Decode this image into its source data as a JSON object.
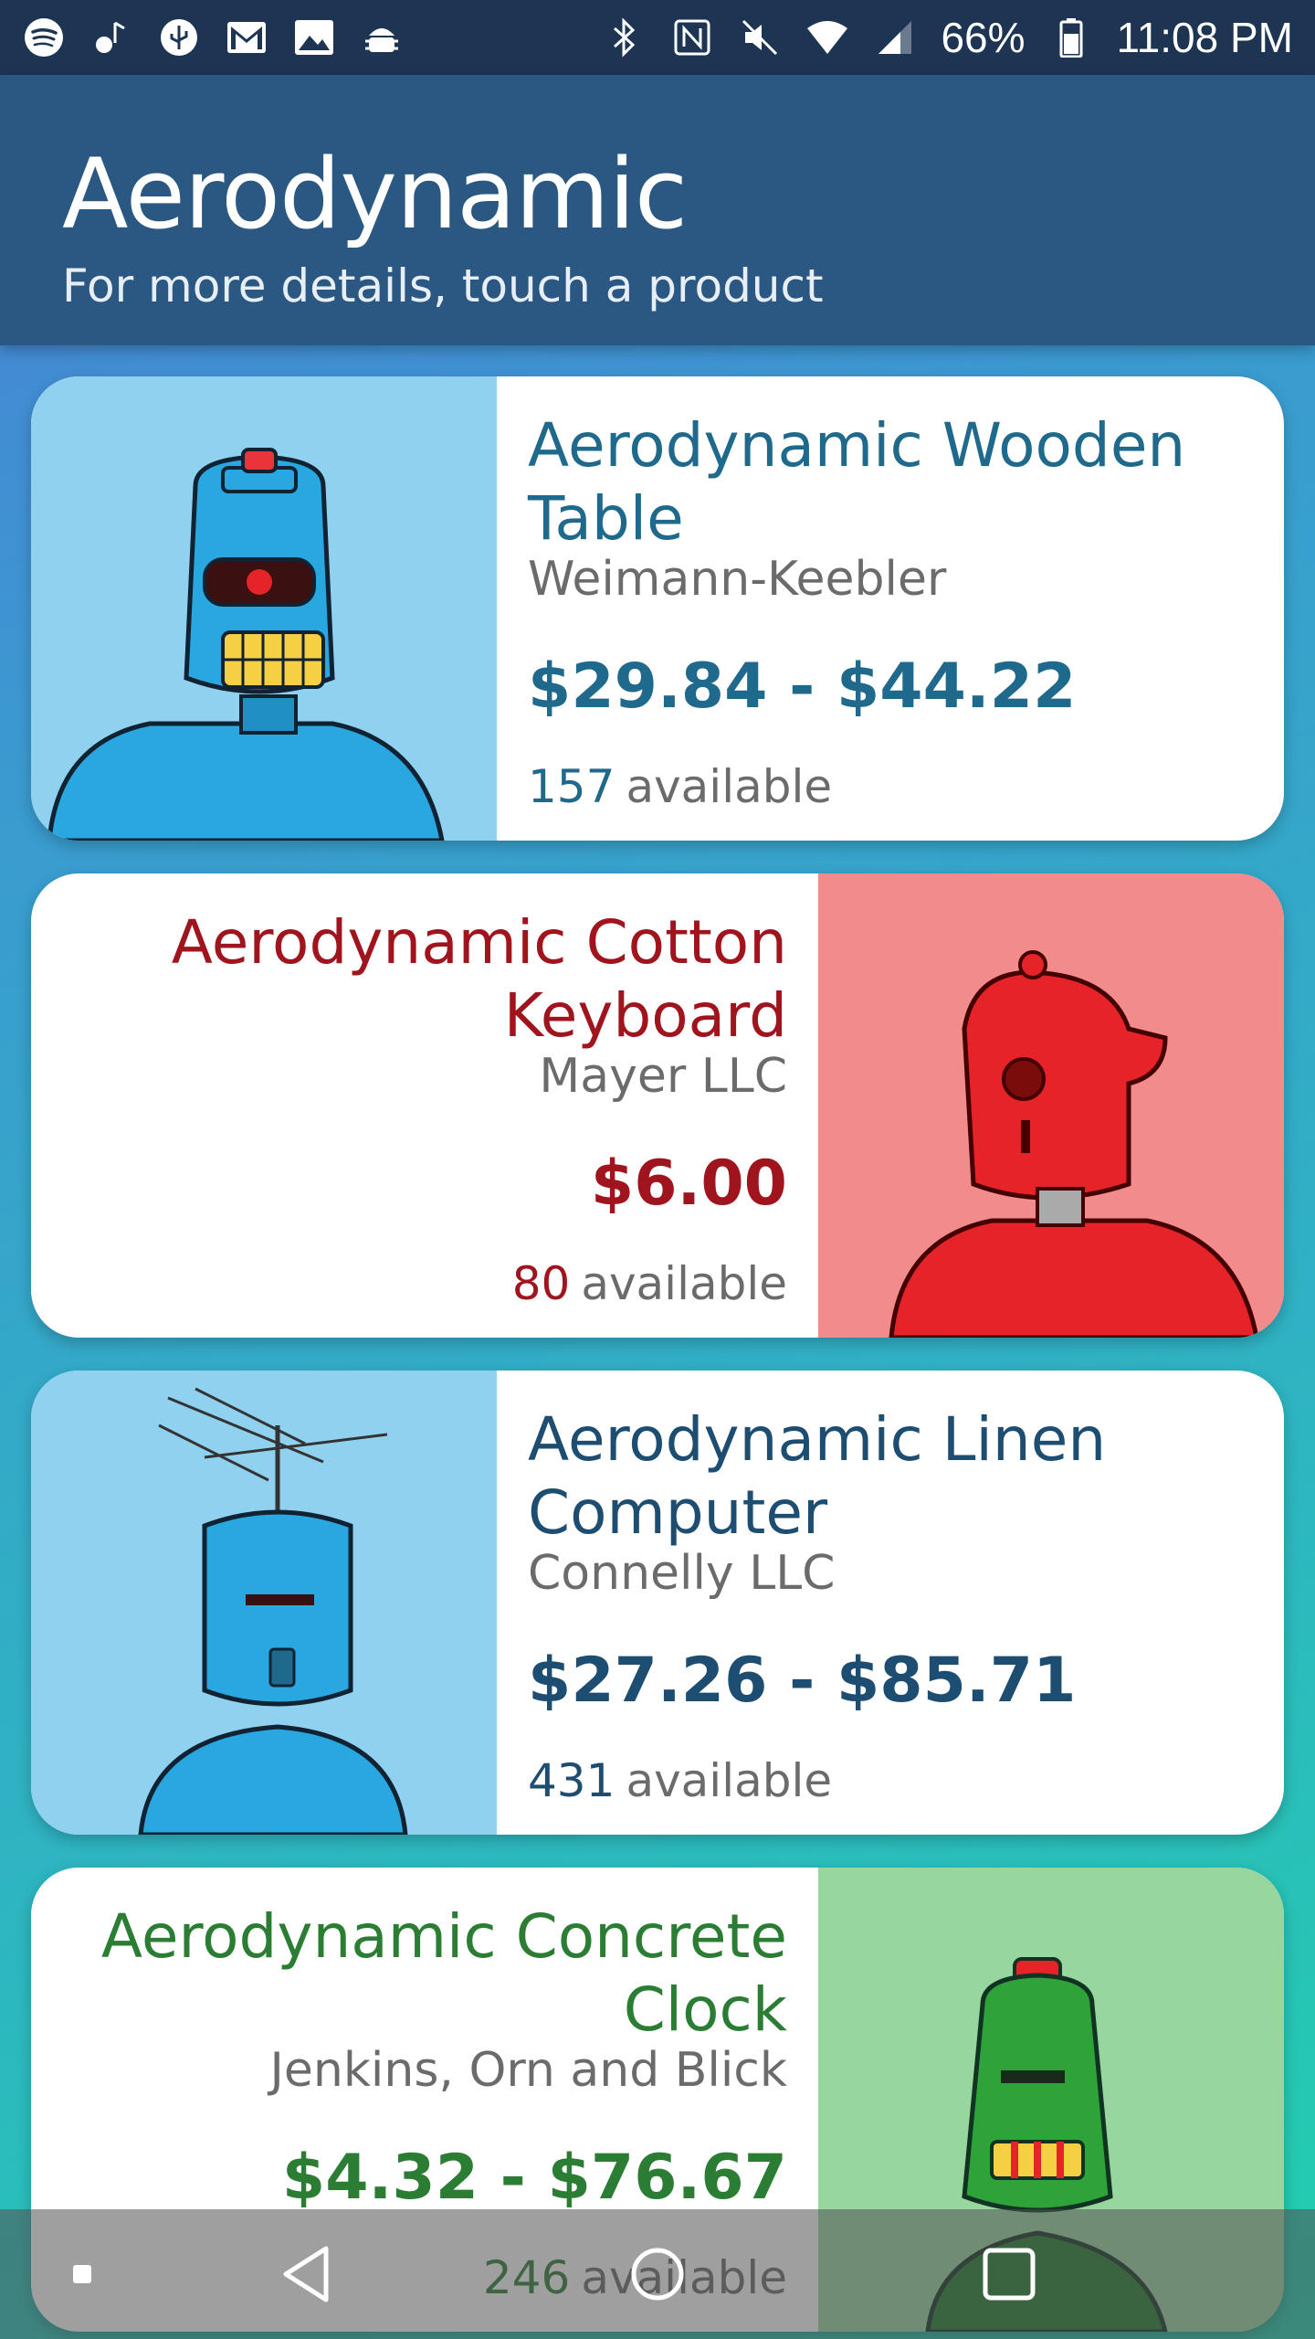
{
  "status_bar": {
    "left_icons": [
      "spotify-icon",
      "bluetooth-audio-icon",
      "usb-icon",
      "gmail-icon",
      "gallery-icon",
      "android-debug-icon"
    ],
    "right_icons": [
      "bluetooth-icon",
      "nfc-icon",
      "mute-icon",
      "wifi-icon",
      "signal-icon"
    ],
    "battery": "66%",
    "time": "11:08 PM"
  },
  "app_bar": {
    "title": "Aerodynamic",
    "subtitle": "For more details, touch a product"
  },
  "products": [
    {
      "name_line1": "Aerodynamic Wooden",
      "name_line2": "Table",
      "vendor": "Weimann-Keebler",
      "price": "$29.84 - $44.22",
      "count": "157",
      "available_label": "available",
      "accent": "#1f6a8c",
      "image_bg": "#8fd1ee",
      "robot_color": "#29a7e0"
    },
    {
      "name_line1": "Aerodynamic Cotton",
      "name_line2": "Keyboard",
      "vendor": "Mayer LLC",
      "price": "$6.00",
      "count": "80",
      "available_label": "available",
      "accent": "#a0141e",
      "image_bg": "#f28b8b",
      "robot_color": "#e52329"
    },
    {
      "name_line1": "Aerodynamic Linen",
      "name_line2": "Computer",
      "vendor": "Connelly LLC",
      "price": "$27.26 - $85.71",
      "count": "431",
      "available_label": "available",
      "accent": "#1e4d72",
      "image_bg": "#8fd1ee",
      "robot_color": "#29a7e0"
    },
    {
      "name_line1": "Aerodynamic Concrete",
      "name_line2": "Clock",
      "vendor": "Jenkins, Orn and Blick",
      "price": "$4.32 - $76.67",
      "count": "246",
      "available_label": "available",
      "accent": "#2a7d32",
      "image_bg": "#97d69f",
      "robot_color": "#2da33a"
    }
  ],
  "nav_bar": {
    "buttons": [
      "recents-dot-icon",
      "back-icon",
      "home-icon",
      "overview-icon"
    ]
  }
}
